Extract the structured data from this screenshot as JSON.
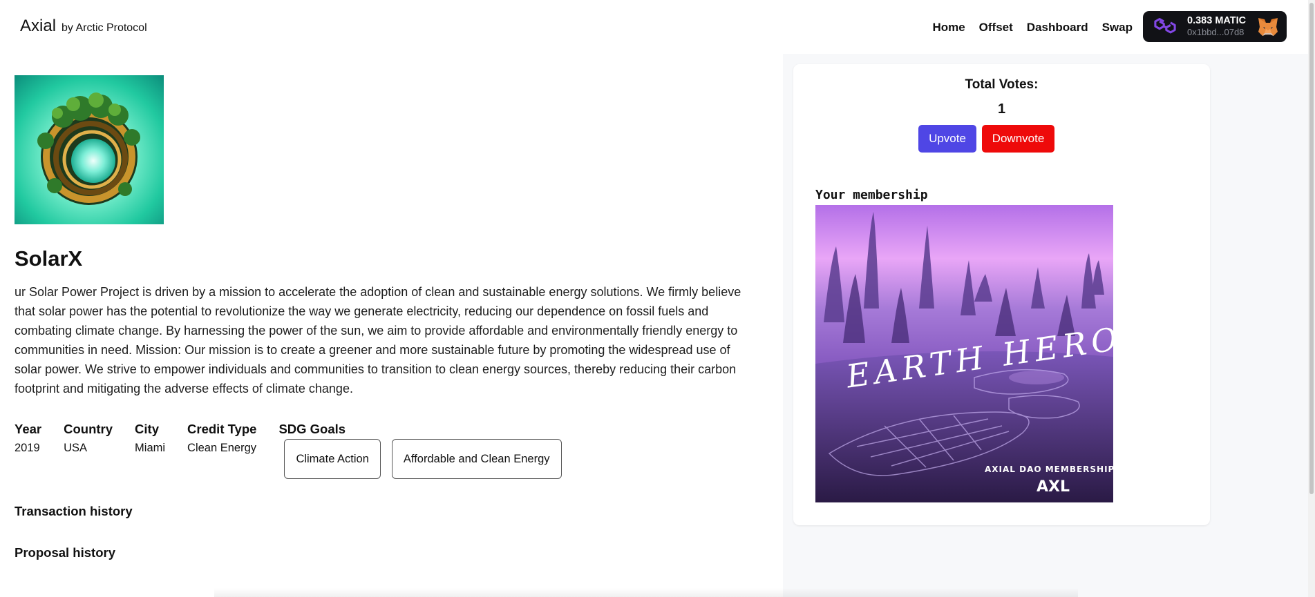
{
  "header": {
    "brand_name": "Axial",
    "brand_by": "by Arctic Protocol",
    "nav": [
      "Home",
      "Offset",
      "Dashboard",
      "Swap"
    ]
  },
  "wallet": {
    "balance": "0.383 MATIC",
    "address": "0x1bbd...07d8",
    "chain_icon": "polygon-icon",
    "wallet_icon": "metamask-fox-icon"
  },
  "project": {
    "title": "SolarX",
    "description": "ur Solar Power Project is driven by a mission to accelerate the adoption of clean and sustainable energy solutions. We firmly believe that solar power has the potential to revolutionize the way we generate electricity, reducing our dependence on fossil fuels and combating climate change. By harnessing the power of the sun, we aim to provide affordable and environmentally friendly energy to communities in need. Mission: Our mission is to create a greener and more sustainable future by promoting the widespread use of solar power. We strive to empower individuals and communities to transition to clean energy sources, thereby reducing their carbon footprint and mitigating the adverse effects of climate change.",
    "facts": {
      "year_label": "Year",
      "year": "2019",
      "country_label": "Country",
      "country": "USA",
      "city_label": "City",
      "city": "Miami",
      "credit_label": "Credit Type",
      "credit": "Clean Energy",
      "sdg_label": "SDG Goals"
    },
    "sdg_goals": [
      "Climate Action",
      "Affordable and Clean Energy"
    ]
  },
  "sections": {
    "transactions": "Transaction history",
    "proposals": "Proposal history"
  },
  "votes": {
    "label": "Total Votes:",
    "count": "1",
    "upvote": "Upvote",
    "downvote": "Downvote"
  },
  "membership": {
    "label": "Your membership",
    "card_title": "EARTH HEROS",
    "card_subtitle": "AXIAL DAO MEMBERSHIP",
    "card_token": "AXL"
  },
  "colors": {
    "upvote": "#4f46e5",
    "downvote": "#ee0a0a",
    "wallet_bg": "#111216",
    "polygon": "#8247e5"
  }
}
